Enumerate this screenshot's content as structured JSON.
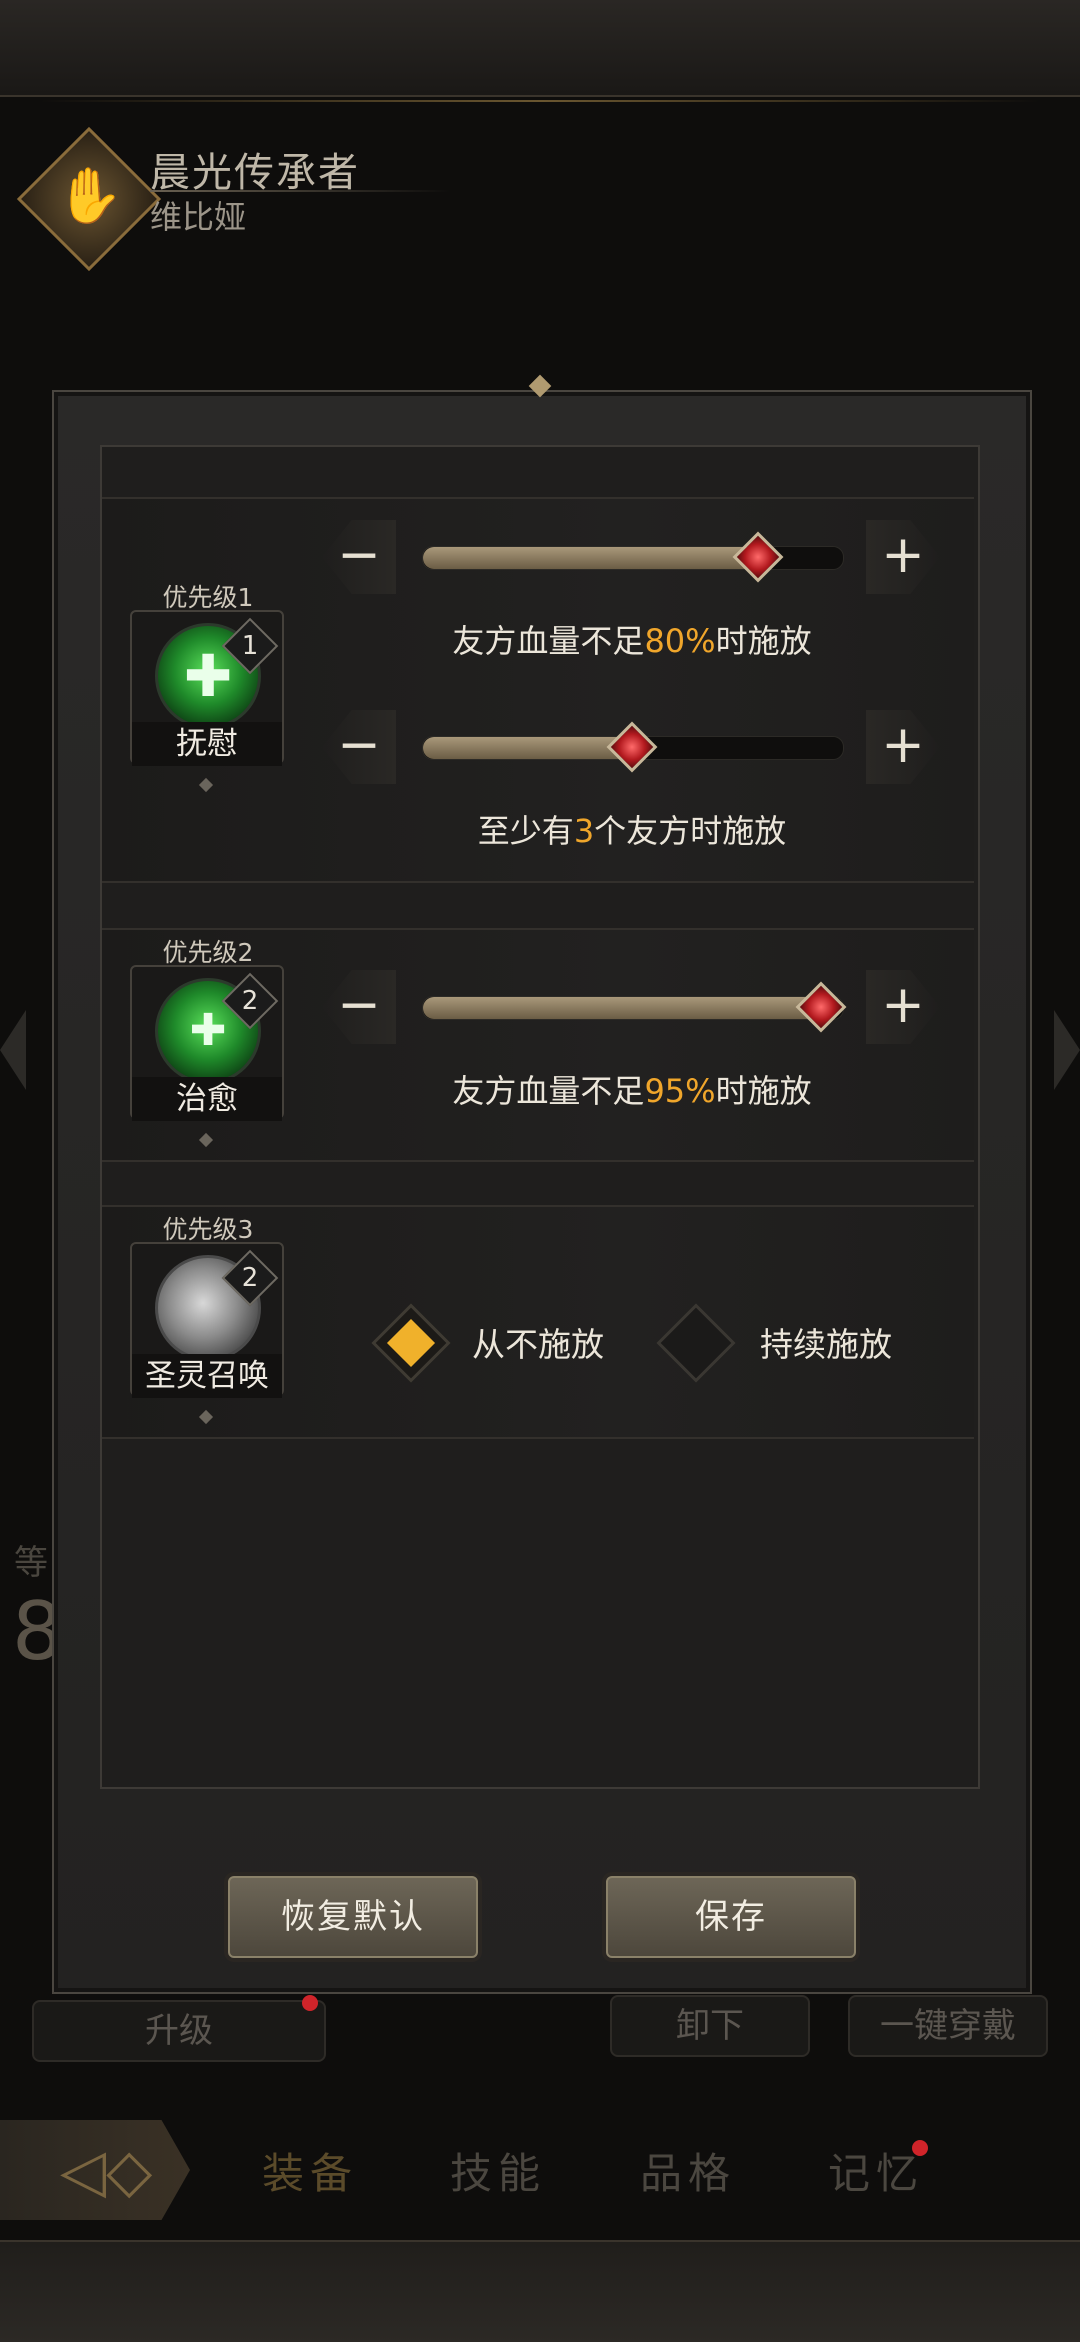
{
  "header": {
    "title": "晨光传承者",
    "name": "维比娅"
  },
  "background": {
    "upgrade_label": "升级",
    "unequip_label": "卸下",
    "equip_all_label": "一键穿戴",
    "level_partial": "等",
    "level_value_partial": "8"
  },
  "nav": {
    "tabs": [
      {
        "label": "装备"
      },
      {
        "label": "技能"
      },
      {
        "label": "品格"
      },
      {
        "label": "记忆"
      }
    ]
  },
  "dialog": {
    "rows": [
      {
        "priority": "优先级1",
        "skill_name": "抚慰",
        "skill_level": "1",
        "sliders": [
          {
            "value": 0.8,
            "text_before": "友方血量不足",
            "highlight": "80%",
            "text_after": "时施放"
          },
          {
            "value": 0.5,
            "text_before": "至少有",
            "highlight": "3",
            "text_after": "个友方时施放"
          }
        ]
      },
      {
        "priority": "优先级2",
        "skill_name": "治愈",
        "skill_level": "2",
        "sliders": [
          {
            "value": 0.95,
            "text_before": "友方血量不足",
            "highlight": "95%",
            "text_after": "时施放"
          }
        ]
      },
      {
        "priority": "优先级3",
        "skill_name": "圣灵召唤",
        "skill_level": "2",
        "options": [
          {
            "label": "从不施放",
            "selected": true
          },
          {
            "label": "持续施放",
            "selected": false
          }
        ]
      }
    ],
    "reset_label": "恢复默认",
    "save_label": "保存"
  },
  "icons": {
    "minus": "−",
    "plus": "+",
    "heal_cross": "✚",
    "multi_cross": "✚"
  },
  "colors": {
    "highlight": "#f0a62b",
    "knob": "#c0232a"
  }
}
